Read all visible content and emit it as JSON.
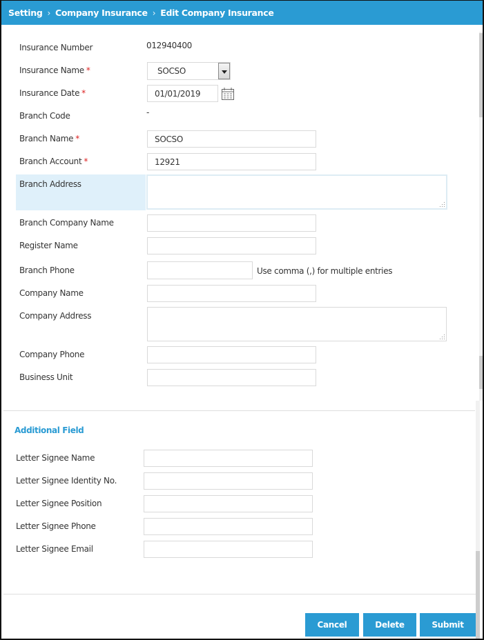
{
  "breadcrumb": {
    "items": [
      "Setting",
      "Company Insurance",
      "Edit Company Insurance"
    ],
    "separator": "›"
  },
  "form": {
    "insurance_number": {
      "label": "Insurance Number",
      "value": "012940400"
    },
    "insurance_name": {
      "label": "Insurance Name",
      "required": "*",
      "value": "SOCSO"
    },
    "insurance_date": {
      "label": "Insurance Date",
      "required": "*",
      "value": "01/01/2019"
    },
    "branch_code": {
      "label": "Branch Code",
      "value": "-"
    },
    "branch_name": {
      "label": "Branch Name",
      "required": "*",
      "value": "SOCSO"
    },
    "branch_account": {
      "label": "Branch Account",
      "required": "*",
      "value": "12921"
    },
    "branch_address": {
      "label": "Branch Address",
      "value": ""
    },
    "branch_company_name": {
      "label": "Branch Company Name",
      "value": ""
    },
    "register_name": {
      "label": "Register Name",
      "value": ""
    },
    "branch_phone": {
      "label": "Branch Phone",
      "value": "",
      "hint": "Use comma (,) for multiple entries"
    },
    "company_name": {
      "label": "Company Name",
      "value": ""
    },
    "company_address": {
      "label": "Company Address",
      "value": ""
    },
    "company_phone": {
      "label": "Company Phone",
      "value": ""
    },
    "business_unit": {
      "label": "Business Unit",
      "value": ""
    }
  },
  "additional": {
    "title": "Additional Field",
    "fields": [
      {
        "label": "Letter Signee Name",
        "value": ""
      },
      {
        "label": "Letter Signee Identity No.",
        "value": ""
      },
      {
        "label": "Letter Signee Position",
        "value": ""
      },
      {
        "label": "Letter Signee Phone",
        "value": ""
      },
      {
        "label": "Letter Signee Email",
        "value": ""
      }
    ]
  },
  "actions": {
    "cancel": "Cancel",
    "delete": "Delete",
    "submit": "Submit"
  },
  "icons": {
    "insurance_name_dropdown": "chevron-down-icon",
    "insurance_date_picker": "calendar-icon"
  },
  "colors": {
    "accent": "#2a9bd3",
    "required": "#dd2222",
    "focus_row": "#dff0fa"
  }
}
